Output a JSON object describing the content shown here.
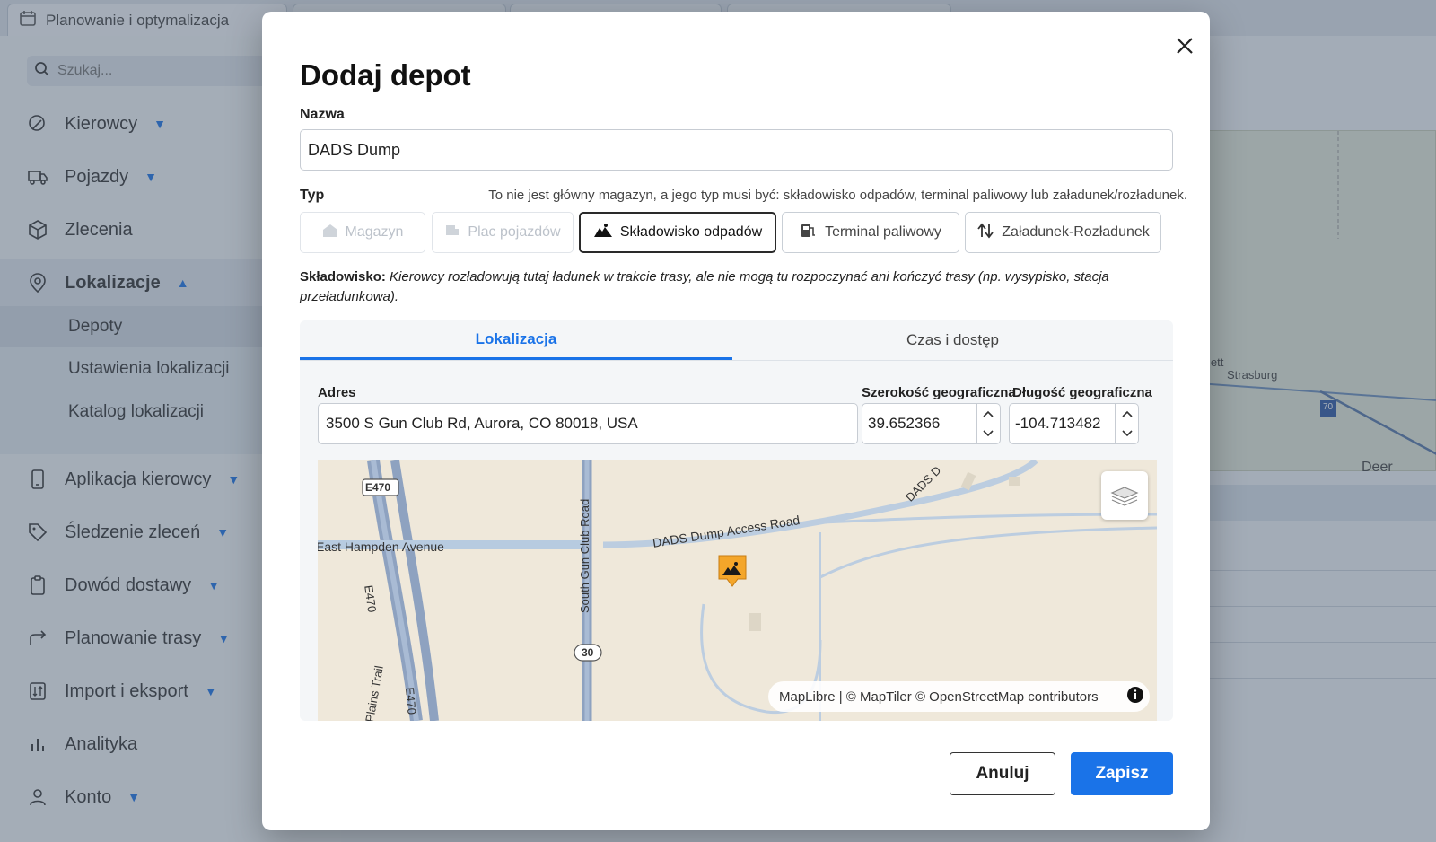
{
  "background": {
    "tabs": [
      "Planowanie i optymalizacja"
    ],
    "search_placeholder": "Szukaj...",
    "nav": [
      {
        "label": "Kierowcy",
        "icon": "drivers-icon"
      },
      {
        "label": "Pojazdy",
        "icon": "truck-icon"
      },
      {
        "label": "Zlecenia",
        "icon": "package-icon"
      },
      {
        "label": "Lokalizacje",
        "icon": "location-pin-icon"
      },
      {
        "label": "Aplikacja kierowcy",
        "icon": "phone-icon"
      },
      {
        "label": "Śledzenie zleceń",
        "icon": "tag-icon"
      },
      {
        "label": "Dowód dostawy",
        "icon": "clipboard-icon"
      },
      {
        "label": "Planowanie trasy",
        "icon": "route-arrow-icon"
      },
      {
        "label": "Import i eksport",
        "icon": "import-export-icon"
      },
      {
        "label": "Analityka",
        "icon": "bar-chart-icon"
      },
      {
        "label": "Konto",
        "icon": "user-icon"
      }
    ],
    "subnav": [
      "Depoty",
      "Ustawienia lokalizacji",
      "Katalog lokalizacji"
    ],
    "map_labels": [
      "lesgett",
      "Strasburg",
      "Deer",
      "70"
    ]
  },
  "modal": {
    "title": "Dodaj depot",
    "name_label": "Nazwa",
    "name_value": "DADS Dump",
    "type_label": "Typ",
    "type_hint": "To nie jest główny magazyn, a jego typ musi być: składowisko odpadów, terminal paliwowy lub załadunek/rozładunek.",
    "types": [
      {
        "label": "Magazyn",
        "state": "disabled"
      },
      {
        "label": "Plac pojazdów",
        "state": "disabled"
      },
      {
        "label": "Składowisko odpadów",
        "state": "selected"
      },
      {
        "label": "Terminal paliwowy",
        "state": "enabled"
      },
      {
        "label": "Załadunek-Rozładunek",
        "state": "enabled"
      }
    ],
    "description_title": "Składowisko:",
    "description_text": "Kierowcy rozładowują tutaj ładunek w trakcie trasy, ale nie mogą tu rozpoczynać ani kończyć trasy (np. wysypisko, stacja przeładunkowa).",
    "panel_tabs": [
      {
        "label": "Lokalizacja",
        "active": true
      },
      {
        "label": "Czas i dostęp",
        "active": false
      }
    ],
    "address_label": "Adres",
    "address_value": "3500 S Gun Club Rd, Aurora, CO 80018, USA",
    "latitude_label": "Szerokość geograficzna",
    "latitude_value": "39.652366",
    "longitude_label": "Długość geograficzna",
    "longitude_value": "-104.713482",
    "map": {
      "road_labels": [
        "E470",
        "East Hampden Avenue",
        "E470",
        "South Gun Club Road",
        "DADS Dump Access Road",
        "DADS D",
        "30",
        "Plains Trail",
        "E470"
      ],
      "attribution": "MapLibre | © MapTiler © OpenStreetMap contributors"
    },
    "cancel_label": "Anuluj",
    "save_label": "Zapisz"
  }
}
